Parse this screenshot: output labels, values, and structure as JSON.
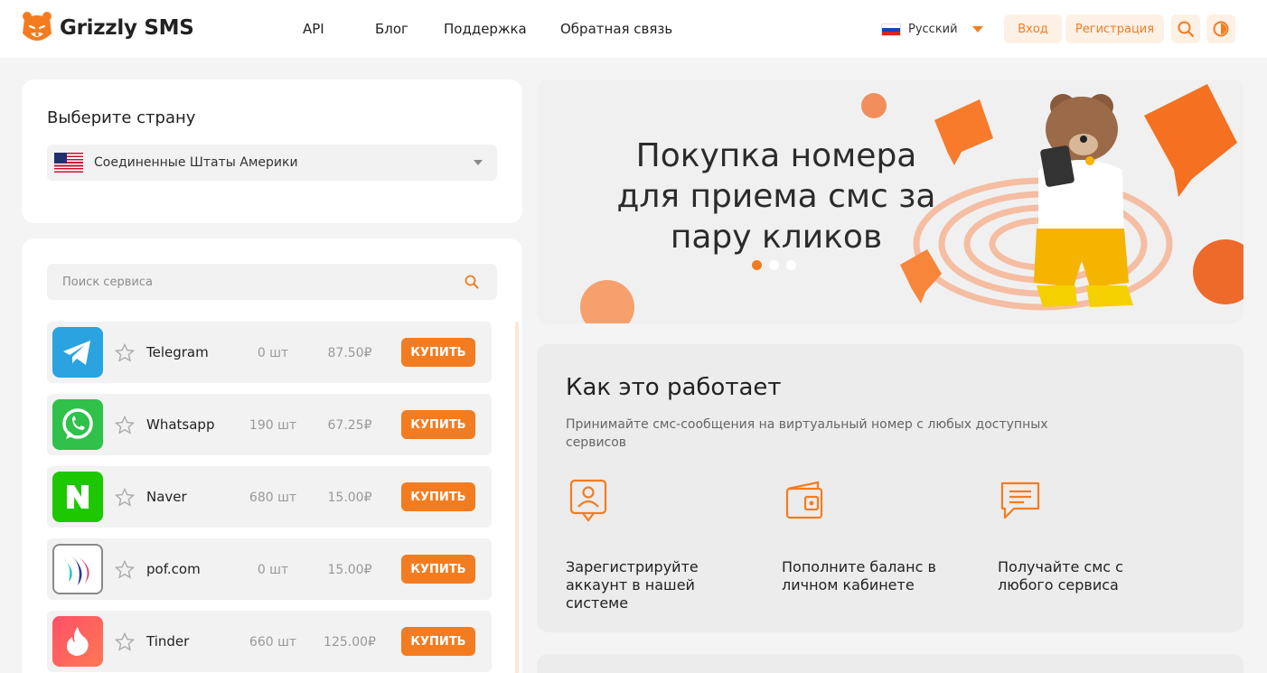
{
  "header": {
    "brand": "Grizzly SMS",
    "nav": [
      "API",
      "Блог",
      "Поддержка",
      "Обратная связь"
    ],
    "language": "Русский",
    "login_label": "Вход",
    "register_label": "Регистрация"
  },
  "country": {
    "title": "Выберите страну",
    "selected": "Соединенные Штаты Америки"
  },
  "search": {
    "placeholder": "Поиск сервиса"
  },
  "services": [
    {
      "name": "Telegram",
      "count": "0 шт",
      "price": "87.50₽",
      "buy": "купить",
      "icon": "telegram-icon"
    },
    {
      "name": "Whatsapp",
      "count": "190 шт",
      "price": "67.25₽",
      "buy": "купить",
      "icon": "whatsapp-icon"
    },
    {
      "name": "Naver",
      "count": "680 шт",
      "price": "15.00₽",
      "buy": "купить",
      "icon": "naver-icon"
    },
    {
      "name": "pof.com",
      "count": "0 шт",
      "price": "15.00₽",
      "buy": "купить",
      "icon": "pof-icon"
    },
    {
      "name": "Tinder",
      "count": "660 шт",
      "price": "125.00₽",
      "buy": "купить",
      "icon": "tinder-icon"
    }
  ],
  "banner": {
    "title": "Покупка номера для приема смс за пару кликов",
    "slides": 3,
    "active_slide": 1
  },
  "how": {
    "title": "Как это работает",
    "subtitle": "Принимайте смс-сообщения на виртуальный номер с любых доступных сервисов",
    "steps": [
      {
        "text": "Зарегистрируйте аккаунт в нашей системе",
        "icon": "user-card-icon"
      },
      {
        "text": "Пополните баланс в личном кабинете",
        "icon": "wallet-icon"
      },
      {
        "text": "Получайте смс с любого сервиса",
        "icon": "message-icon"
      }
    ]
  },
  "colors": {
    "accent": "#f47c20",
    "accent_light": "#fdf1e6",
    "background": "#f4f4f4"
  }
}
